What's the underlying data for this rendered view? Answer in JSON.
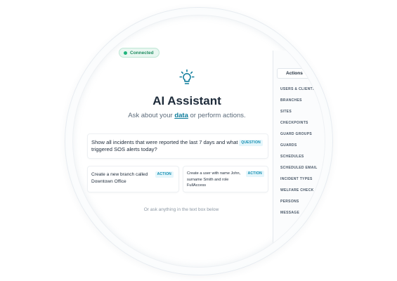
{
  "status": {
    "label": "Connected",
    "color": "#1fb47c"
  },
  "header": {
    "icon": "lightbulb-icon",
    "title": "AI Assistant",
    "subtitle_prefix": "Ask about your ",
    "subtitle_link": "data",
    "subtitle_suffix": " or perform actions."
  },
  "suggestions": [
    {
      "text": "Show all incidents that were reported the last 7 days and what triggered SOS alerts today?",
      "tag": "QUESTION"
    },
    {
      "text": "Create a new branch called Downtown Office",
      "tag": "ACTION"
    },
    {
      "text": "Create a user with name John, surname Smith and role FullAccess",
      "tag": "ACTION"
    }
  ],
  "hint": "Or ask anything in the text box below",
  "side_panel": {
    "tab_label": "Actions",
    "items": [
      "USERS & CLIENTS",
      "BRANCHES",
      "SITES",
      "CHECKPOINTS",
      "GUARD GROUPS",
      "GUARDS",
      "SCHEDULES",
      "SCHEDULED EMAIL",
      "INCIDENT TYPES",
      "WELFARE CHECK",
      "PERSONS",
      "MESSAGE"
    ]
  },
  "colors": {
    "accent": "#0d7c9b",
    "tag_bg": "#e5f6fb",
    "tag_text": "#0f8cb0"
  }
}
